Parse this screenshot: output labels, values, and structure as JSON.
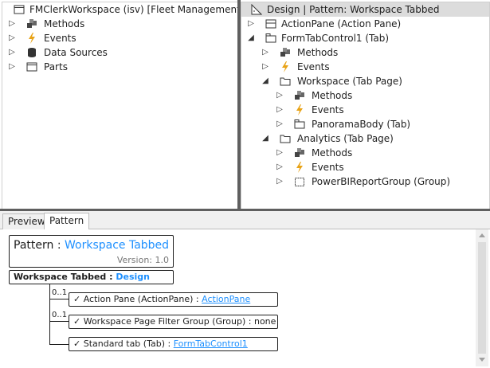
{
  "left_tree": {
    "root": "FMClerkWorkspace (isv) [Fleet Management]",
    "items": [
      "Methods",
      "Events",
      "Data Sources",
      "Parts"
    ]
  },
  "right_tree": {
    "root": "Design | Pattern: Workspace Tabbed",
    "nodes": [
      "ActionPane (Action Pane)",
      "FormTabControl1 (Tab)",
      "Methods",
      "Events",
      "Workspace (Tab Page)",
      "Methods",
      "Events",
      "PanoramaBody (Tab)",
      "Analytics (Tab Page)",
      "Methods",
      "Events",
      "PowerBIReportGroup (Group)"
    ]
  },
  "tabs": [
    "Preview",
    "Pattern"
  ],
  "pattern": {
    "label": "Pattern",
    "separator": ":",
    "name": "Workspace Tabbed",
    "version_label": "Version:",
    "version": "1.0",
    "design_title": "Workspace Tabbed",
    "design_link": "Design",
    "items": [
      {
        "card": "0..1",
        "check": "✓",
        "text": "Action Pane  (ActionPane)  :",
        "value": "ActionPane",
        "linked": true
      },
      {
        "card": "0..1",
        "check": "✓",
        "text": "Workspace Page Filter Group  (Group)  :",
        "value": "none",
        "linked": false
      },
      {
        "card": "",
        "check": "✓",
        "text": "Standard tab  (Tab)  :",
        "value": "FormTabControl1",
        "linked": true
      }
    ]
  }
}
